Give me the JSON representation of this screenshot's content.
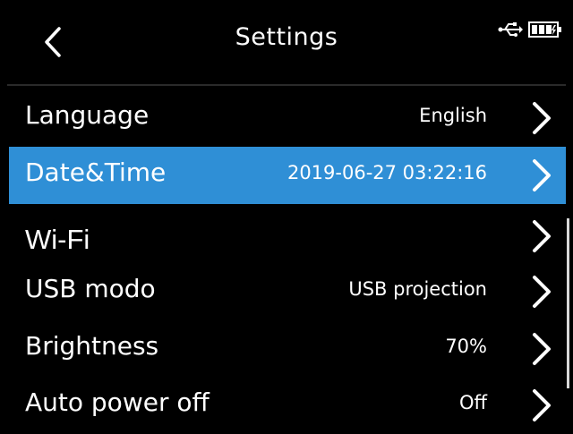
{
  "header": {
    "title": "Settings",
    "back_icon": "chevron-left-icon",
    "status_icons": [
      "usb-icon",
      "battery-icon"
    ]
  },
  "settings": [
    {
      "label": "Language",
      "value": "English",
      "selected": false
    },
    {
      "label": "Date&Time",
      "value": "2019-06-27 03:22:16",
      "selected": true
    },
    {
      "label": "Wi-Fi",
      "value": "",
      "selected": false
    },
    {
      "label": "USB modo",
      "value": "USB projection",
      "selected": false
    },
    {
      "label": "Brightness",
      "value": "70%",
      "selected": false
    },
    {
      "label": "Auto power off",
      "value": "Off",
      "selected": false
    }
  ],
  "colors": {
    "background": "#000000",
    "selected_row": "#2f8fd6",
    "text": "#ffffff"
  }
}
